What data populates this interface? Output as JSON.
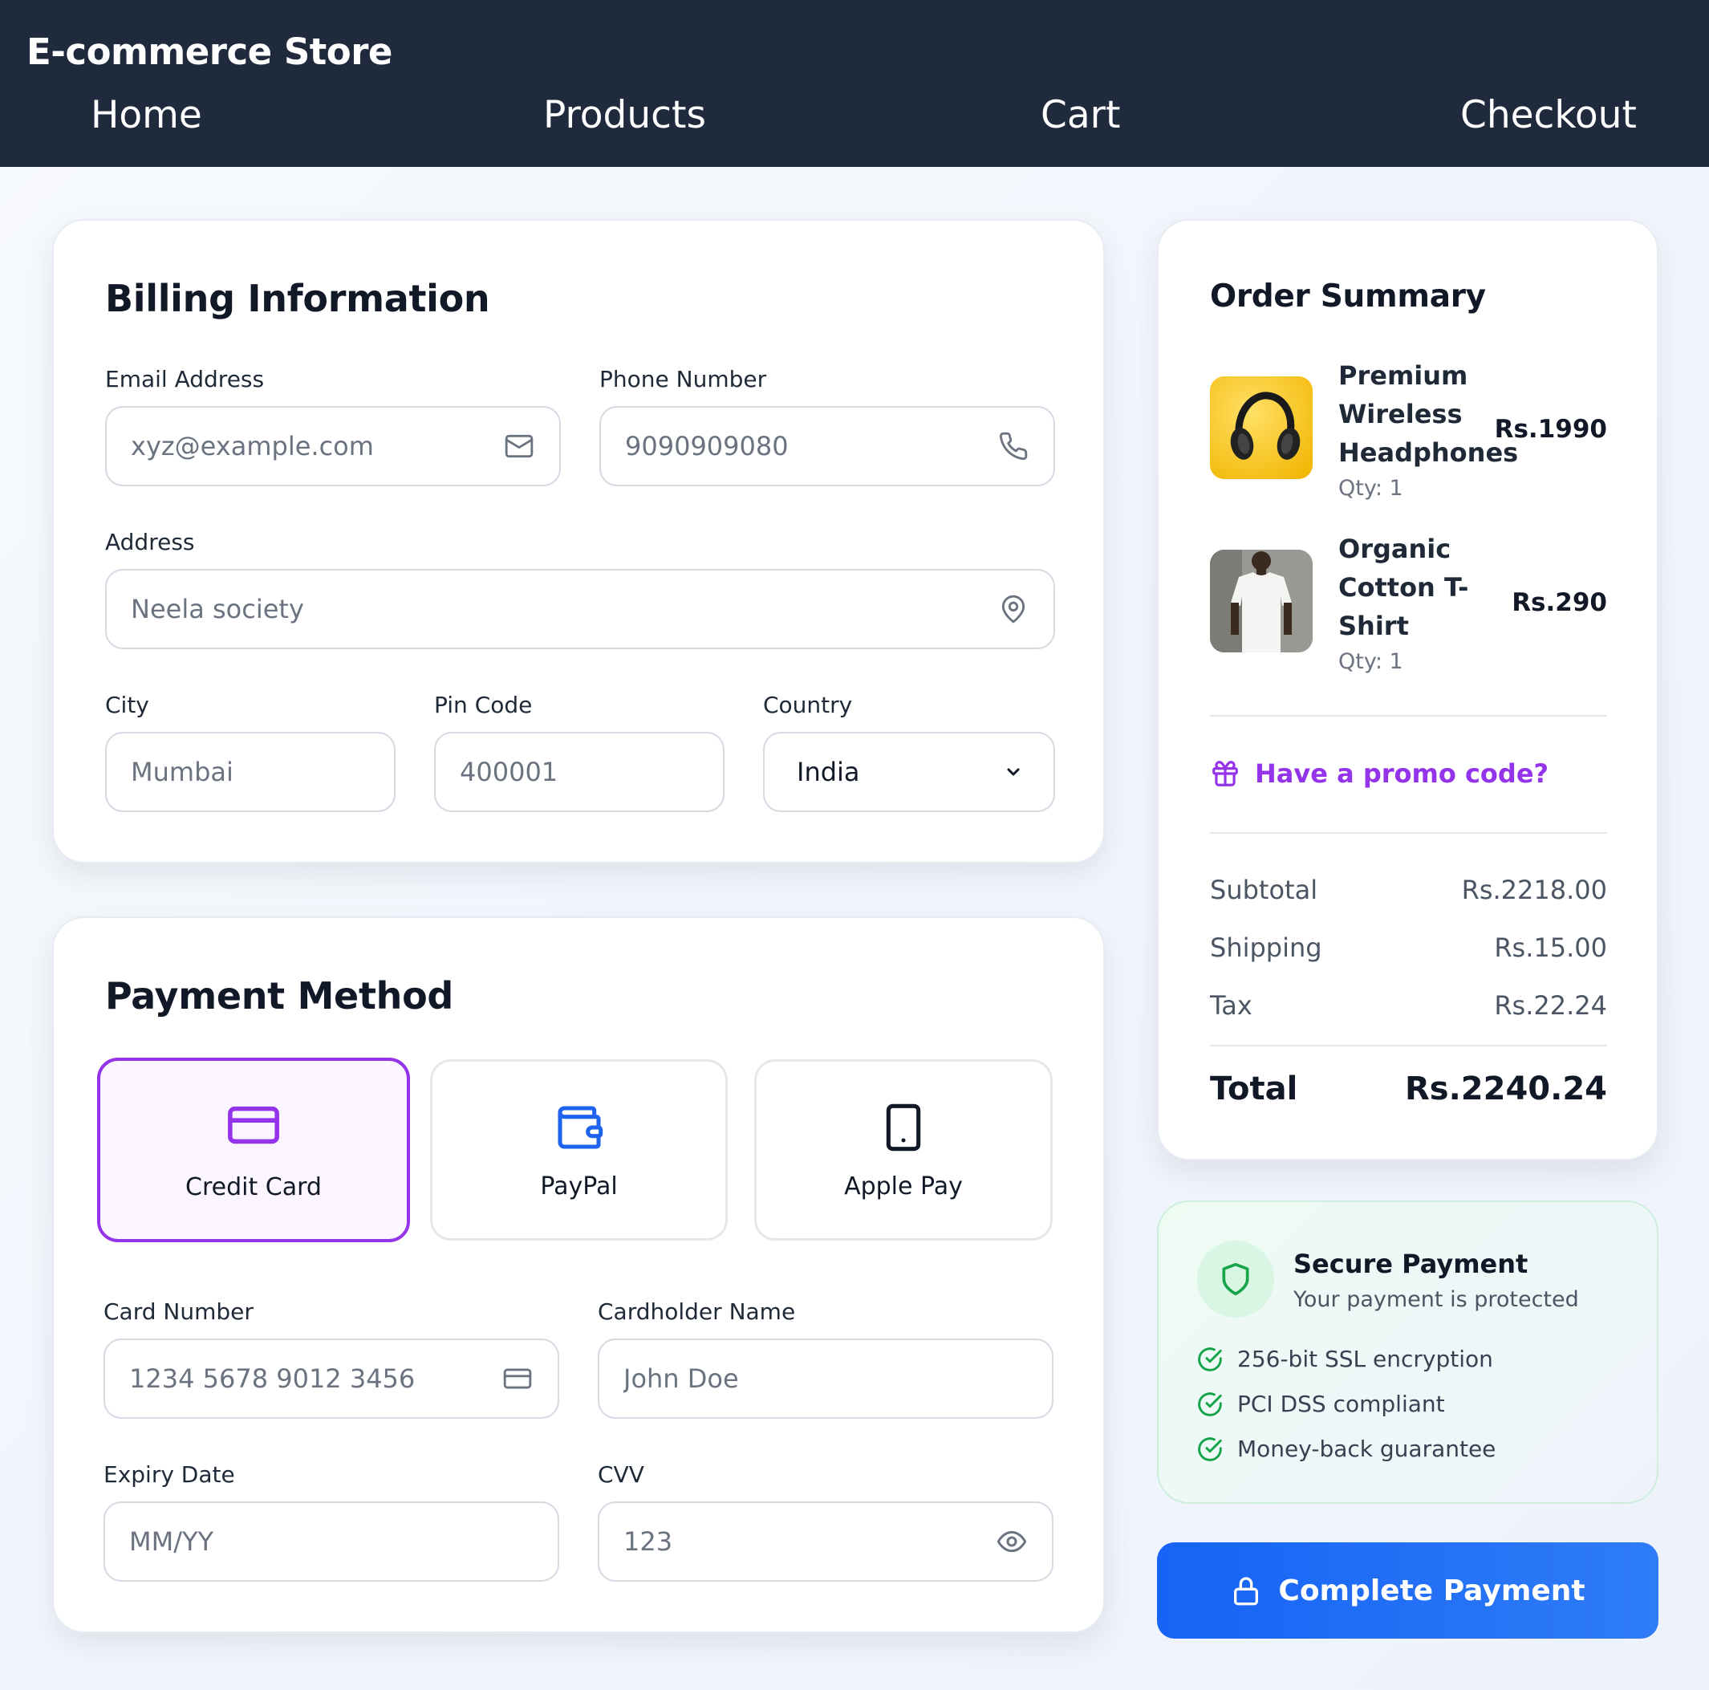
{
  "header": {
    "brand": "E-commerce Store",
    "nav": [
      "Home",
      "Products",
      "Cart",
      "Checkout"
    ]
  },
  "billing": {
    "title": "Billing Information",
    "email": {
      "label": "Email Address",
      "placeholder": "xyz@example.com",
      "icon": "mail-icon"
    },
    "phone": {
      "label": "Phone Number",
      "placeholder": "9090909080",
      "icon": "phone-icon"
    },
    "address": {
      "label": "Address",
      "placeholder": "Neela society",
      "icon": "map-pin-icon"
    },
    "city": {
      "label": "City",
      "placeholder": "Mumbai"
    },
    "pin": {
      "label": "Pin Code",
      "placeholder": "400001"
    },
    "country": {
      "label": "Country",
      "value": "India",
      "icon": "chevron-down-icon"
    }
  },
  "payment": {
    "title": "Payment Method",
    "methods": [
      {
        "label": "Credit Card",
        "icon": "credit-card-icon",
        "selected": true
      },
      {
        "label": "PayPal",
        "icon": "wallet-icon",
        "selected": false
      },
      {
        "label": "Apple Pay",
        "icon": "smartphone-icon",
        "selected": false
      }
    ],
    "card_number": {
      "label": "Card Number",
      "placeholder": "1234 5678 9012 3456",
      "icon": "credit-card-icon"
    },
    "cardholder": {
      "label": "Cardholder Name",
      "placeholder": "John Doe"
    },
    "expiry": {
      "label": "Expiry Date",
      "placeholder": "MM/YY"
    },
    "cvv": {
      "label": "CVV",
      "placeholder": "123",
      "icon": "eye-icon"
    }
  },
  "summary": {
    "title": "Order Summary",
    "items": [
      {
        "name_lines": [
          "Premium",
          "Wireless",
          "Headphones"
        ],
        "qty": "Qty: 1",
        "price": "Rs.1990",
        "image": "headphones-image"
      },
      {
        "name_lines": [
          "Organic",
          "Cotton T-",
          "Shirt"
        ],
        "qty": "Qty: 1",
        "price": "Rs.290",
        "image": "tshirt-image"
      }
    ],
    "promo": "Have a promo code?",
    "subtotal": {
      "label": "Subtotal",
      "value": "Rs.2218.00"
    },
    "shipping": {
      "label": "Shipping",
      "value": "Rs.15.00"
    },
    "tax": {
      "label": "Tax",
      "value": "Rs.22.24"
    },
    "total": {
      "label": "Total",
      "value": "Rs.2240.24"
    }
  },
  "secure": {
    "title": "Secure Payment",
    "subtitle": "Your payment is protected",
    "features": [
      "256-bit SSL encryption",
      "PCI DSS compliant",
      "Money-back guarantee"
    ]
  },
  "cta": {
    "label": "Complete Payment",
    "icon": "lock-icon"
  },
  "colors": {
    "header_bg": "#1f2a3c",
    "accent_purple": "#9333ea",
    "accent_blue": "#1663f5",
    "success_green": "#16a34a"
  }
}
